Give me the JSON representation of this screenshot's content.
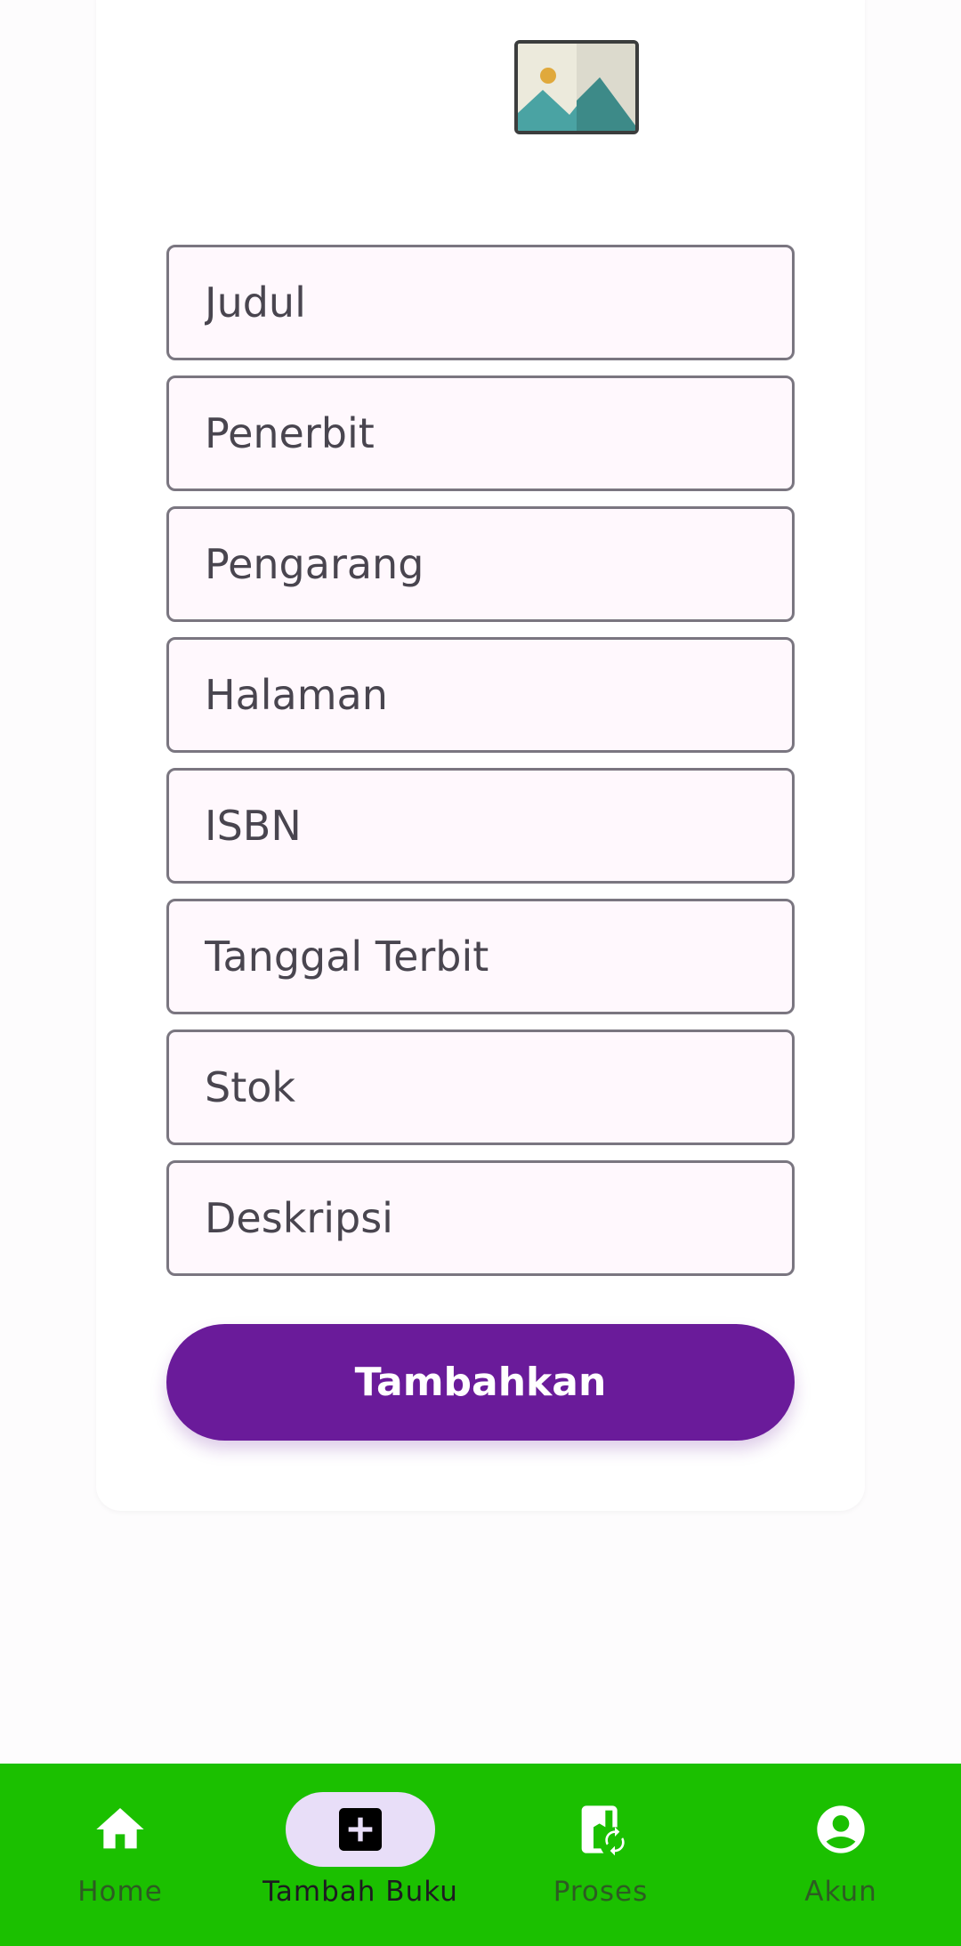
{
  "form": {
    "image_placeholder_icon": "image-icon",
    "fields": [
      {
        "placeholder": "Judul",
        "value": ""
      },
      {
        "placeholder": "Penerbit",
        "value": ""
      },
      {
        "placeholder": "Pengarang",
        "value": ""
      },
      {
        "placeholder": "Halaman",
        "value": ""
      },
      {
        "placeholder": "ISBN",
        "value": ""
      },
      {
        "placeholder": "Tanggal Terbit",
        "value": ""
      },
      {
        "placeholder": "Stok",
        "value": ""
      },
      {
        "placeholder": "Deskripsi",
        "value": ""
      }
    ],
    "submit_label": "Tambahkan"
  },
  "bottom_nav": {
    "active_index": 1,
    "items": [
      {
        "label": "Home",
        "icon": "home-icon"
      },
      {
        "label": "Tambah Buku",
        "icon": "add-box-icon"
      },
      {
        "label": "Proses",
        "icon": "book-sync-icon"
      },
      {
        "label": "Akun",
        "icon": "account-circle-icon"
      }
    ]
  },
  "colors": {
    "primary": "#6a1b9a",
    "nav_background": "#1bc000",
    "active_pill": "#e8def8",
    "field_background": "#fff8fd",
    "field_border": "#7a7680"
  }
}
